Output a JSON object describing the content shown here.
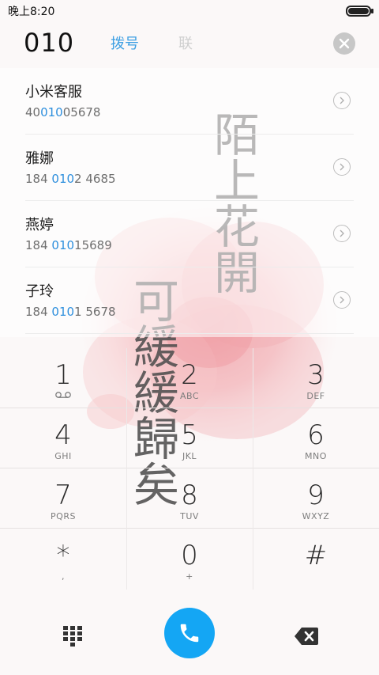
{
  "status_bar": {
    "time": "晚上8:20"
  },
  "header": {
    "input_digits": "010",
    "tabs": [
      {
        "label": "拨号",
        "state": "active"
      },
      {
        "label": "联",
        "state": "faded"
      }
    ]
  },
  "results": [
    {
      "name": "小米客服",
      "number_before": "40",
      "number_match": "010",
      "number_after": "05678"
    },
    {
      "name": "雅娜",
      "number_before": "184 ",
      "number_match": "010",
      "number_after": "2 4685"
    },
    {
      "name": "燕婷",
      "number_before": "184 ",
      "number_match": "010",
      "number_after": "15689"
    },
    {
      "name": "子玲",
      "number_before": "184 ",
      "number_match": "010",
      "number_after": "1 5678"
    }
  ],
  "keypad": [
    {
      "digit": "1",
      "letters": ""
    },
    {
      "digit": "2",
      "letters": "ABC"
    },
    {
      "digit": "3",
      "letters": "DEF"
    },
    {
      "digit": "4",
      "letters": "GHI"
    },
    {
      "digit": "5",
      "letters": "JKL"
    },
    {
      "digit": "6",
      "letters": "MNO"
    },
    {
      "digit": "7",
      "letters": "PQRS"
    },
    {
      "digit": "8",
      "letters": "TUV"
    },
    {
      "digit": "9",
      "letters": "WXYZ"
    },
    {
      "digit": "*",
      "letters": ","
    },
    {
      "digit": "0",
      "letters": "+"
    },
    {
      "digit": "#",
      "letters": ""
    }
  ],
  "wallpaper_text": {
    "right_column": "陌上花開",
    "left_column": "可緩緩歸矣"
  },
  "colors": {
    "accent": "#3c9fe3",
    "call_button": "#14a6f4",
    "highlight": "#2e8fdd",
    "flower": "#f2b8bc"
  },
  "icons": {
    "clear": "clear-x-icon",
    "info": "chevron-right-icon",
    "voicemail": "voicemail-icon",
    "dialpad": "dialpad-grid-icon",
    "call": "phone-icon",
    "backspace": "backspace-icon"
  }
}
